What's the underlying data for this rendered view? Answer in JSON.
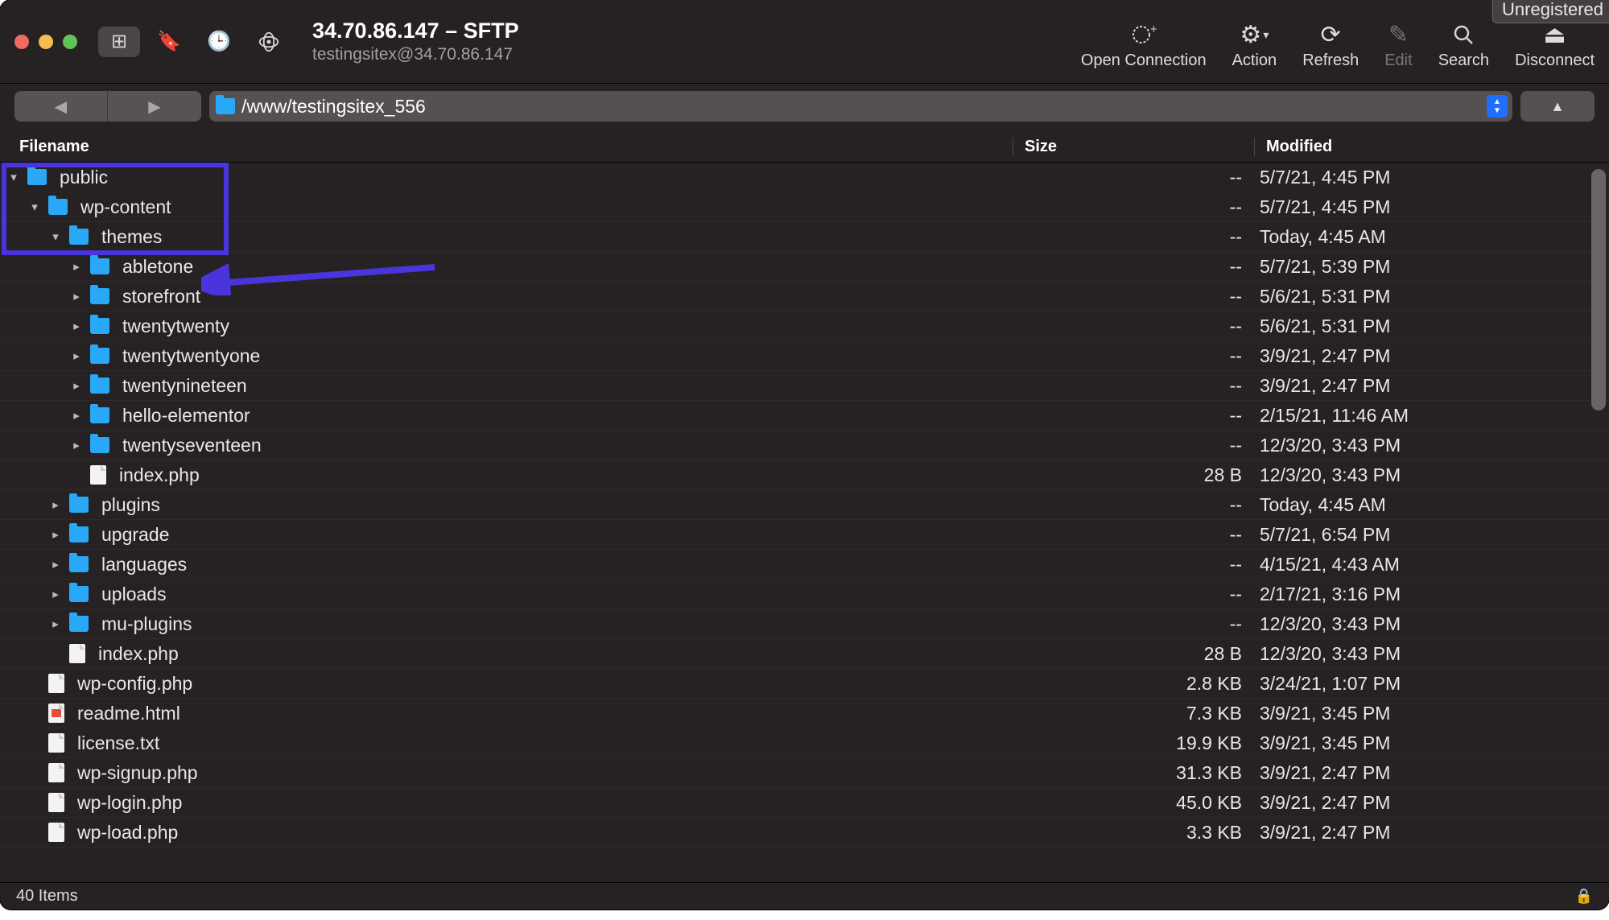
{
  "badge": "Unregistered",
  "title": {
    "main": "34.70.86.147 – SFTP",
    "sub": "testingsitex@34.70.86.147"
  },
  "toolbar": {
    "open": "Open Connection",
    "action": "Action",
    "refresh": "Refresh",
    "edit": "Edit",
    "search": "Search",
    "disconnect": "Disconnect"
  },
  "path": "/www/testingsitex_556",
  "columns": {
    "name": "Filename",
    "size": "Size",
    "modified": "Modified"
  },
  "rows": [
    {
      "depth": 0,
      "disc": "v",
      "type": "folder",
      "name": "public",
      "size": "--",
      "mod": "5/7/21, 4:45 PM",
      "hl": true
    },
    {
      "depth": 1,
      "disc": "v",
      "type": "folder",
      "name": "wp-content",
      "size": "--",
      "mod": "5/7/21, 4:45 PM",
      "hl": true
    },
    {
      "depth": 2,
      "disc": "v",
      "type": "folder",
      "name": "themes",
      "size": "--",
      "mod": "Today, 4:45 AM",
      "hl": true
    },
    {
      "depth": 3,
      "disc": ">",
      "type": "folder",
      "name": "abletone",
      "size": "--",
      "mod": "5/7/21, 5:39 PM"
    },
    {
      "depth": 3,
      "disc": ">",
      "type": "folder",
      "name": "storefront",
      "size": "--",
      "mod": "5/6/21, 5:31 PM"
    },
    {
      "depth": 3,
      "disc": ">",
      "type": "folder",
      "name": "twentytwenty",
      "size": "--",
      "mod": "5/6/21, 5:31 PM"
    },
    {
      "depth": 3,
      "disc": ">",
      "type": "folder",
      "name": "twentytwentyone",
      "size": "--",
      "mod": "3/9/21, 2:47 PM"
    },
    {
      "depth": 3,
      "disc": ">",
      "type": "folder",
      "name": "twentynineteen",
      "size": "--",
      "mod": "3/9/21, 2:47 PM"
    },
    {
      "depth": 3,
      "disc": ">",
      "type": "folder",
      "name": "hello-elementor",
      "size": "--",
      "mod": "2/15/21, 11:46 AM"
    },
    {
      "depth": 3,
      "disc": ">",
      "type": "folder",
      "name": "twentyseventeen",
      "size": "--",
      "mod": "12/3/20, 3:43 PM"
    },
    {
      "depth": 3,
      "disc": "",
      "type": "file",
      "name": "index.php",
      "size": "28 B",
      "mod": "12/3/20, 3:43 PM"
    },
    {
      "depth": 2,
      "disc": ">",
      "type": "folder",
      "name": "plugins",
      "size": "--",
      "mod": "Today, 4:45 AM"
    },
    {
      "depth": 2,
      "disc": ">",
      "type": "folder",
      "name": "upgrade",
      "size": "--",
      "mod": "5/7/21, 6:54 PM"
    },
    {
      "depth": 2,
      "disc": ">",
      "type": "folder",
      "name": "languages",
      "size": "--",
      "mod": "4/15/21, 4:43 AM"
    },
    {
      "depth": 2,
      "disc": ">",
      "type": "folder",
      "name": "uploads",
      "size": "--",
      "mod": "2/17/21, 3:16 PM"
    },
    {
      "depth": 2,
      "disc": ">",
      "type": "folder",
      "name": "mu-plugins",
      "size": "--",
      "mod": "12/3/20, 3:43 PM"
    },
    {
      "depth": 2,
      "disc": "",
      "type": "file",
      "name": "index.php",
      "size": "28 B",
      "mod": "12/3/20, 3:43 PM"
    },
    {
      "depth": 1,
      "disc": "",
      "type": "file",
      "name": "wp-config.php",
      "size": "2.8 KB",
      "mod": "3/24/21, 1:07 PM"
    },
    {
      "depth": 1,
      "disc": "",
      "type": "html",
      "name": "readme.html",
      "size": "7.3 KB",
      "mod": "3/9/21, 3:45 PM"
    },
    {
      "depth": 1,
      "disc": "",
      "type": "file",
      "name": "license.txt",
      "size": "19.9 KB",
      "mod": "3/9/21, 3:45 PM"
    },
    {
      "depth": 1,
      "disc": "",
      "type": "file",
      "name": "wp-signup.php",
      "size": "31.3 KB",
      "mod": "3/9/21, 2:47 PM"
    },
    {
      "depth": 1,
      "disc": "",
      "type": "file",
      "name": "wp-login.php",
      "size": "45.0 KB",
      "mod": "3/9/21, 2:47 PM"
    },
    {
      "depth": 1,
      "disc": "",
      "type": "file",
      "name": "wp-load.php",
      "size": "3.3 KB",
      "mod": "3/9/21, 2:47 PM"
    }
  ],
  "status": "40 Items"
}
